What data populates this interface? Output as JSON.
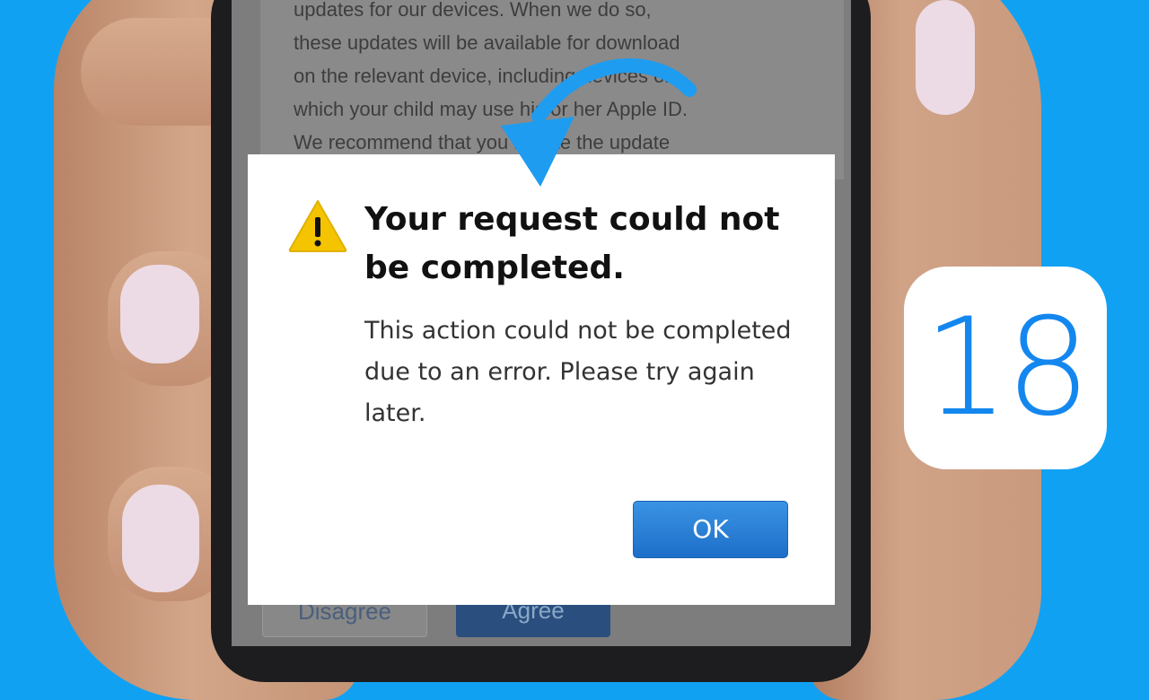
{
  "background_text": [
    "updates for our devices. When we do so,",
    "these updates will be available for download",
    "on the relevant device, including devices on",
    "which your child may use his or her Apple ID.",
    "We recommend that you initiate the update"
  ],
  "background_buttons": {
    "disagree_label": "Disagree",
    "agree_label": "Agree"
  },
  "dialog": {
    "icon": "warning-triangle-icon",
    "title": "Your request could not be completed.",
    "message": "This action could not be completed due to an error. Please try again later.",
    "ok_label": "OK"
  },
  "badge": {
    "number": "18"
  },
  "colors": {
    "background": "#11a1f3",
    "ok_button": "#2a80d6",
    "badge_text": "#1487ef",
    "warning": "#f5c400"
  }
}
